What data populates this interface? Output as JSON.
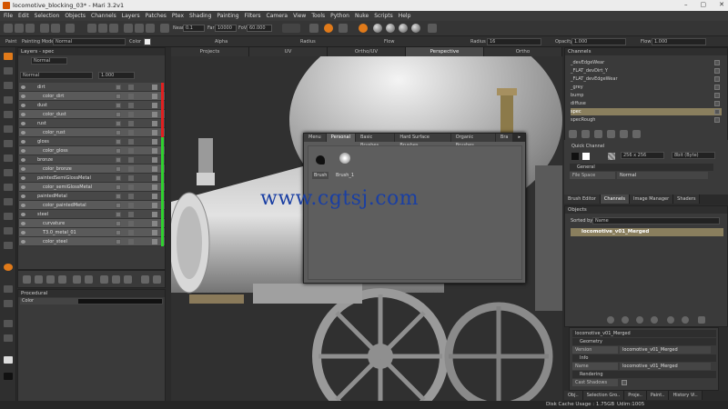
{
  "window": {
    "title": "locomotive_blocking_03* - Mari 3.2v1",
    "controls": [
      "–",
      "▢",
      "✕"
    ]
  },
  "menu": [
    "File",
    "Edit",
    "Selection",
    "Objects",
    "Channels",
    "Layers",
    "Patches",
    "Ptex",
    "Shading",
    "Painting",
    "Filters",
    "Camera",
    "View",
    "Tools",
    "Python",
    "Nuke",
    "Scripts",
    "Help"
  ],
  "toolbar": {
    "near_label": "Near",
    "near_value": "0.1",
    "far_label": "Far",
    "far_value": "10000",
    "fov_label": "FoV",
    "fov_value": "60.000"
  },
  "paintbar": {
    "paint_label": "Paint",
    "mode_label": "Painting Mode",
    "mode_value": "Normal",
    "color_label": "Color",
    "alpha_label": "Alpha",
    "radius_label": "Radius",
    "flow_label": "Flow",
    "radius2_label": "Radius",
    "radius2_value": "16",
    "opacity_label": "Opacity",
    "opacity_value": "1.000",
    "flow2_label": "Flow",
    "flow2_value": "1.000"
  },
  "layers": {
    "title": "Layers - spec",
    "channel_value": "Normal",
    "blend_value": "Normal",
    "opacity_value": "1.000",
    "rows": [
      {
        "name": "dirt",
        "type": "g",
        "bar": "#e02020"
      },
      {
        "name": "color_dirt",
        "type": "c",
        "bar": "#e02020"
      },
      {
        "name": "dust",
        "type": "g",
        "bar": "#e02020"
      },
      {
        "name": "color_dust",
        "type": "c",
        "bar": "#e02020"
      },
      {
        "name": "rust",
        "type": "g",
        "bar": "#e02020"
      },
      {
        "name": "color_rust",
        "type": "c",
        "bar": "#e02020"
      },
      {
        "name": "gloss",
        "type": "g",
        "bar": "#30d030"
      },
      {
        "name": "color_gloss",
        "type": "c",
        "bar": "#30d030"
      },
      {
        "name": "bronze",
        "type": "g",
        "bar": "#30d030"
      },
      {
        "name": "color_bronze",
        "type": "c",
        "bar": "#30d030"
      },
      {
        "name": "paintedSemiGlossMetal",
        "type": "g",
        "bar": "#30d030"
      },
      {
        "name": "color_semiGlossMetal",
        "type": "c",
        "bar": "#30d030"
      },
      {
        "name": "paintedMetal",
        "type": "g",
        "bar": "#30d030"
      },
      {
        "name": "color_paintedMetal",
        "type": "c",
        "bar": "#30d030"
      },
      {
        "name": "steel",
        "type": "g",
        "bar": "#30d030"
      },
      {
        "name": "curvature",
        "type": "c",
        "bar": "#30d030"
      },
      {
        "name": "T3.0_metal_01",
        "type": "c",
        "bar": "#30d030"
      },
      {
        "name": "color_steel",
        "type": "c",
        "bar": "#30d030"
      }
    ]
  },
  "procedural": {
    "title": "Procedural",
    "color_label": "Color"
  },
  "viewtabs": [
    "Projects",
    "UV",
    "Ortho/UV",
    "Perspective",
    "Ortho"
  ],
  "viewtabs_active": 3,
  "brushes": {
    "tabs": [
      "Menu",
      "Personal",
      "Basic Brushes",
      "Hard Surface Brushes",
      "Organic Brushes",
      "Bra"
    ],
    "active_tab": 1,
    "items": [
      "Brush",
      "Brush_1"
    ]
  },
  "watermark": "www.cgtsj.com",
  "channels": {
    "title": "Channels",
    "items": [
      "_devEdgeWear",
      "_FLAT_devDirt_Y",
      "_FLAT_devEdgeWear",
      "_grey",
      "bump",
      "diffuse",
      "spec",
      "specRough"
    ],
    "selected": 6,
    "quick_channel_label": "Quick Channel",
    "size_value": "256 x 256",
    "depth_value": "8bit (Byte)",
    "general_label": "General",
    "filespace_key": "File Space",
    "filespace_value": "Normal"
  },
  "right_tabs": [
    "Brush Editor",
    "Channels",
    "Image Manager",
    "Shaders"
  ],
  "right_tabs_active": 1,
  "objects": {
    "title": "Objects",
    "sorted_label": "Sorted by",
    "sorted_value": "Name",
    "item": "locomotive_v01_Merged"
  },
  "props": {
    "title": "locomotive_v01_Merged",
    "geometry": "Geometry",
    "version_key": "Version",
    "version_value": "locomotive_v01_Merged",
    "info": "Info",
    "name_key": "Name",
    "name_value": "locomotive_v01_Merged",
    "rendering": "Rendering",
    "cast_key": "Cast Shadows"
  },
  "bottom_tabs": [
    "Obj..",
    "Selection Gro..",
    "Proje..",
    "Paint..",
    "History Vi.."
  ],
  "status": {
    "disk": "Disk Cache Usage : 1.75GB",
    "udim": "Udim:1005"
  }
}
